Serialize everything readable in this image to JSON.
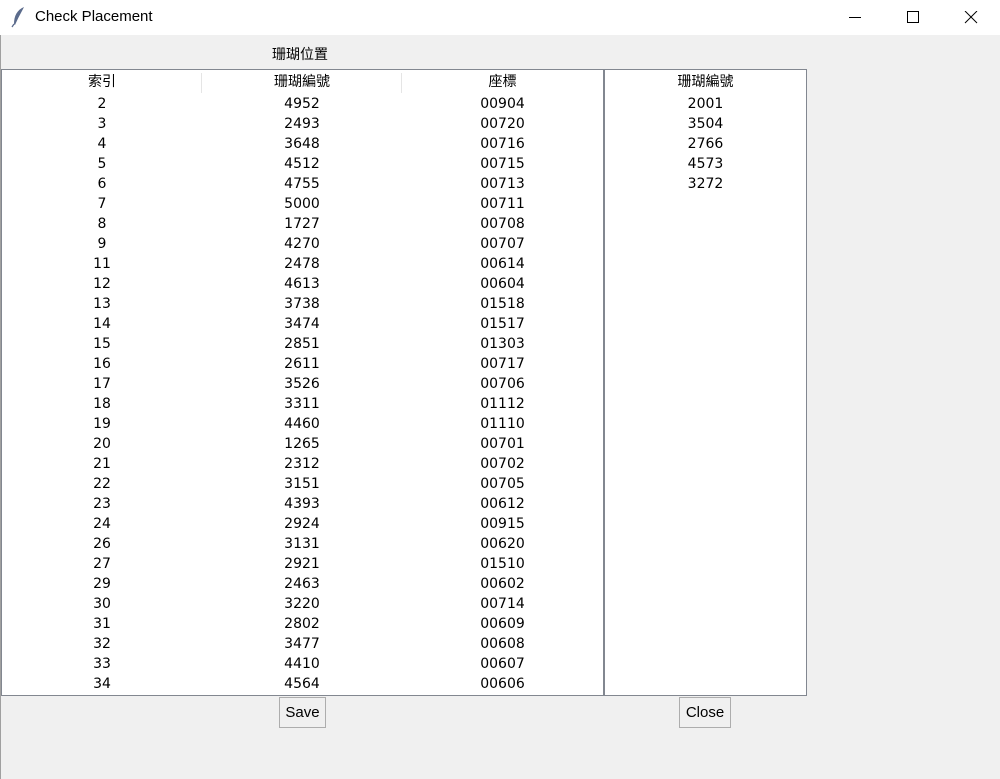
{
  "window": {
    "title": "Check Placement",
    "icon": "feather-icon"
  },
  "frame": {
    "label": "珊瑚位置"
  },
  "main_table": {
    "columns": [
      "索引",
      "珊瑚編號",
      "座標"
    ],
    "rows": [
      [
        "2",
        "4952",
        "00904"
      ],
      [
        "3",
        "2493",
        "00720"
      ],
      [
        "4",
        "3648",
        "00716"
      ],
      [
        "5",
        "4512",
        "00715"
      ],
      [
        "6",
        "4755",
        "00713"
      ],
      [
        "7",
        "5000",
        "00711"
      ],
      [
        "8",
        "1727",
        "00708"
      ],
      [
        "9",
        "4270",
        "00707"
      ],
      [
        "11",
        "2478",
        "00614"
      ],
      [
        "12",
        "4613",
        "00604"
      ],
      [
        "13",
        "3738",
        "01518"
      ],
      [
        "14",
        "3474",
        "01517"
      ],
      [
        "15",
        "2851",
        "01303"
      ],
      [
        "16",
        "2611",
        "00717"
      ],
      [
        "17",
        "3526",
        "00706"
      ],
      [
        "18",
        "3311",
        "01112"
      ],
      [
        "19",
        "4460",
        "01110"
      ],
      [
        "20",
        "1265",
        "00701"
      ],
      [
        "21",
        "2312",
        "00702"
      ],
      [
        "22",
        "3151",
        "00705"
      ],
      [
        "23",
        "4393",
        "00612"
      ],
      [
        "24",
        "2924",
        "00915"
      ],
      [
        "26",
        "3131",
        "00620"
      ],
      [
        "27",
        "2921",
        "01510"
      ],
      [
        "29",
        "2463",
        "00602"
      ],
      [
        "30",
        "3220",
        "00714"
      ],
      [
        "31",
        "2802",
        "00609"
      ],
      [
        "32",
        "3477",
        "00608"
      ],
      [
        "33",
        "4410",
        "00607"
      ],
      [
        "34",
        "4564",
        "00606"
      ]
    ]
  },
  "side_table": {
    "column": "珊瑚編號",
    "rows": [
      "2001",
      "3504",
      "2766",
      "4573",
      "3272"
    ]
  },
  "buttons": {
    "save": "Save",
    "close": "Close"
  }
}
